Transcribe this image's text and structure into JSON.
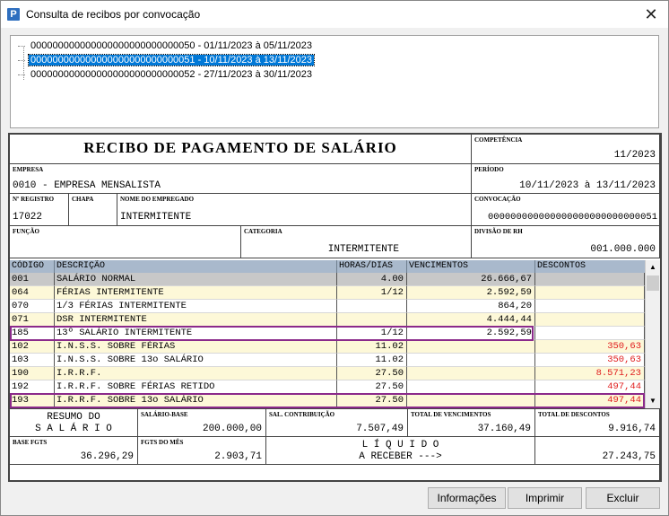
{
  "window": {
    "title": "Consulta de recibos por convocação",
    "icon": "P"
  },
  "tree": {
    "items": [
      {
        "label": "000000000000000000000000000050 - 01/11/2023 à 05/11/2023",
        "selected": false
      },
      {
        "label": "000000000000000000000000000051 - 10/11/2023 à 13/11/2023",
        "selected": true
      },
      {
        "label": "000000000000000000000000000052 - 27/11/2023 à 30/11/2023",
        "selected": false
      }
    ]
  },
  "recibo": {
    "title": "RECIBO DE PAGAMENTO DE SALÁRIO",
    "competencia_label": "COMPETÊNCIA",
    "competencia": "11/2023",
    "empresa_label": "EMPRESA",
    "empresa": "0010 - EMPRESA MENSALISTA",
    "periodo_label": "PERÍODO",
    "periodo": "10/11/2023 à 13/11/2023",
    "registro_label": "Nº REGISTRO",
    "registro": "17022",
    "chapa_label": "CHAPA",
    "chapa": "",
    "nome_label": "NOME DO EMPREGADO",
    "nome": "INTERMITENTE",
    "convocacao_label": "CONVOCAÇÃO",
    "convocacao": "000000000000000000000000000051",
    "funcao_label": "FUNÇÃO",
    "funcao": "",
    "categoria_label": "CATEGORIA",
    "categoria": "INTERMITENTE",
    "divisao_label": "DIVISÃO DE RH",
    "divisao": "001.000.000"
  },
  "grid": {
    "headers": [
      "CÓDIGO",
      "DESCRIÇÃO",
      "HORAS/DIAS",
      "VENCIMENTOS",
      "DESCONTOS"
    ],
    "rows": [
      {
        "codigo": "001",
        "descricao": "SALÁRIO NORMAL",
        "horas": "4.00",
        "vencimentos": "26.666,67",
        "descontos": ""
      },
      {
        "codigo": "064",
        "descricao": "FÉRIAS INTERMITENTE",
        "horas": "1/12",
        "vencimentos": "2.592,59",
        "descontos": ""
      },
      {
        "codigo": "070",
        "descricao": "1/3 FÉRIAS INTERMITENTE",
        "horas": "",
        "vencimentos": "864,20",
        "descontos": ""
      },
      {
        "codigo": "071",
        "descricao": "DSR INTERMITENTE",
        "horas": "",
        "vencimentos": "4.444,44",
        "descontos": ""
      },
      {
        "codigo": "185",
        "descricao": "13º SALÁRIO INTERMITENTE",
        "horas": "1/12",
        "vencimentos": "2.592,59",
        "descontos": ""
      },
      {
        "codigo": "102",
        "descricao": "I.N.S.S. SOBRE FÉRIAS",
        "horas": "11.02",
        "vencimentos": "",
        "descontos": "350,63"
      },
      {
        "codigo": "103",
        "descricao": "I.N.S.S. SOBRE 13o SALÁRIO",
        "horas": "11.02",
        "vencimentos": "",
        "descontos": "350,63"
      },
      {
        "codigo": "190",
        "descricao": "I.R.R.F.",
        "horas": "27.50",
        "vencimentos": "",
        "descontos": "8.571,23"
      },
      {
        "codigo": "192",
        "descricao": "I.R.R.F. SOBRE FÉRIAS RETIDO",
        "horas": "27.50",
        "vencimentos": "",
        "descontos": "497,44"
      },
      {
        "codigo": "193",
        "descricao": "I.R.R.F. SOBRE 13o SALÁRIO",
        "horas": "27.50",
        "vencimentos": "",
        "descontos": "497,44"
      }
    ]
  },
  "totais": {
    "resumo_line1": "RESUMO DO",
    "resumo_line2": "S A L Á R I O",
    "salario_base_label": "SALÁRIO-BASE",
    "salario_base": "200.000,00",
    "sal_contrib_label": "SAL. CONTRIBUIÇÃO",
    "sal_contrib": "7.507,49",
    "total_venc_label": "TOTAL DE VENCIMENTOS",
    "total_venc": "37.160,49",
    "total_desc_label": "TOTAL DE DESCONTOS",
    "total_desc": "9.916,74",
    "base_fgts_label": "BASE FGTS",
    "base_fgts": "36.296,29",
    "fgts_mes_label": "FGTS DO MÊS",
    "fgts_mes": "2.903,71",
    "liquido_line1": "L Í Q U I D O",
    "liquido_line2": "A RECEBER --->",
    "liquido": "27.243,75"
  },
  "buttons": {
    "informacoes": "Informações",
    "imprimir": "Imprimir",
    "excluir": "Excluir"
  },
  "colors": {
    "header_bg": "#a9b9cc",
    "selection": "#0078d7",
    "highlight_border": "#8b2a8b",
    "desconto_text": "#e02020",
    "alt_row": "#fdf8d8"
  }
}
